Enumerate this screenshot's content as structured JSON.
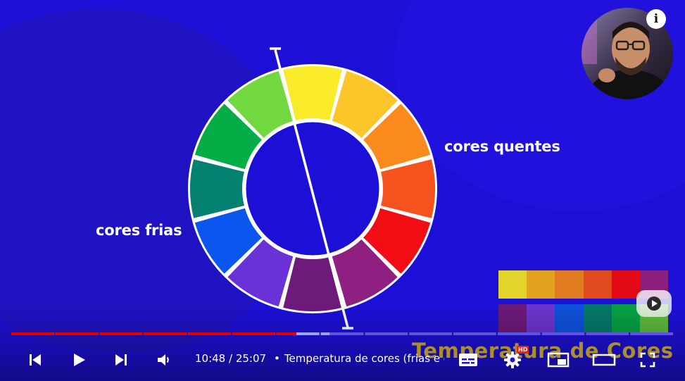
{
  "video": {
    "label_warm": "cores quentes",
    "label_cool": "cores frias",
    "watermark": "Temperatura de Cores",
    "wheel_segments": [
      "#f9ea2a",
      "#fcc52a",
      "#fb8a1e",
      "#f5521d",
      "#f10d13",
      "#8f1f80",
      "#6e1a7a",
      "#6a31d6",
      "#0a56ee",
      "#048070",
      "#06ad47",
      "#71d840"
    ],
    "swatch_rows": [
      [
        "#e3d42b",
        "#e3a21e",
        "#e07c1f",
        "#e04a1c",
        "#e10a16",
        "#8c1e7d"
      ],
      [
        "#6d1a7a",
        "#6c35cf",
        "#0f52dc",
        "#047868",
        "#07a144",
        "#5fb83d"
      ]
    ]
  },
  "player": {
    "time_current": "10:48",
    "time_separator": " / ",
    "time_total": "25:07",
    "chapter_dot": "•",
    "chapter_title": "Temperatura de cores (frias e quentes)",
    "hd_badge": "HD",
    "progress_fraction": 0.43,
    "buffered_fraction": 0.48,
    "info_label": "i"
  },
  "colors": {
    "background": "#1d10d6",
    "progress_played": "#e00000",
    "progress_buffered": "#9aa3ff",
    "progress_track": "#5d55e0"
  }
}
